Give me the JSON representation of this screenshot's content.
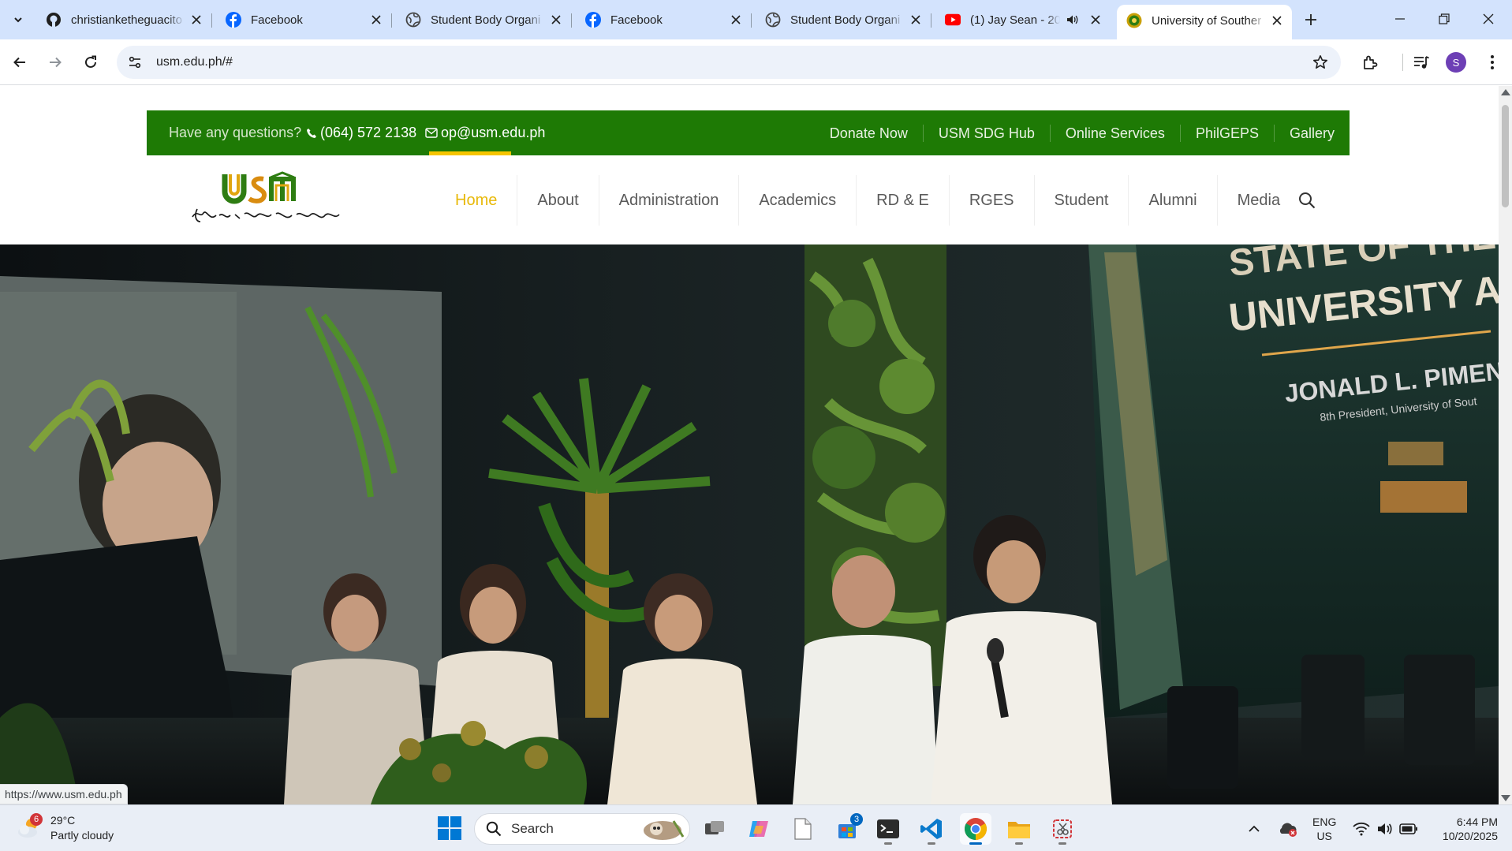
{
  "browser": {
    "tabs": [
      {
        "title": "christianketheguacito",
        "favicon": "github-icon",
        "active": false
      },
      {
        "title": "Facebook",
        "favicon": "facebook-icon",
        "active": false
      },
      {
        "title": "Student Body Organi",
        "favicon": "globe-icon",
        "active": false
      },
      {
        "title": "Facebook",
        "favicon": "facebook-icon",
        "active": false
      },
      {
        "title": "Student Body Organi",
        "favicon": "globe-icon",
        "active": false
      },
      {
        "title": "(1) Jay Sean - 20",
        "favicon": "youtube-icon",
        "active": false,
        "audio": true
      },
      {
        "title": "University of Souther",
        "favicon": "usm-seal-icon",
        "active": true
      }
    ],
    "url": "usm.edu.ph/#",
    "profile_initial": "S",
    "status_url": "https://www.usm.edu.ph"
  },
  "site": {
    "topbar": {
      "question": "Have any questions?",
      "phone": "(064) 572 2138",
      "email": "op@usm.edu.ph",
      "links": [
        "Donate Now",
        "USM SDG Hub",
        "Online Services",
        "PhilGEPS",
        "Gallery"
      ]
    },
    "logo_text": "USM",
    "logo_script": "University of Southern Mindanao",
    "menu": [
      "Home",
      "About",
      "Administration",
      "Academics",
      "RD & E",
      "RGES",
      "Student",
      "Alumni",
      "Media"
    ],
    "active_menu": "Home",
    "hero": {
      "screen_line1": "STATE OF THE",
      "screen_line2": "UNIVERSITY A",
      "screen_name": "JONALD L. PIMENT",
      "screen_role": "8th President, University of Sout"
    },
    "colors": {
      "primary_green": "#1e7a05",
      "accent_yellow": "#e8b90a"
    }
  },
  "taskbar": {
    "weather_temp": "29°C",
    "weather_desc": "Partly cloudy",
    "weather_badge": "6",
    "search_label": "Search",
    "store_badge": "3",
    "lang_line1": "ENG",
    "lang_line2": "US",
    "time": "6:44 PM",
    "date": "10/20/2025"
  }
}
